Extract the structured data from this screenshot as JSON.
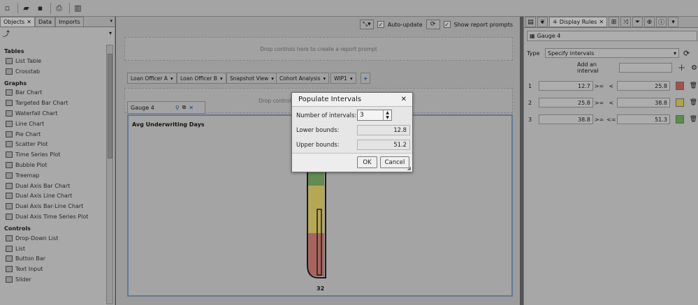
{
  "left_panel": {
    "tabs": [
      {
        "label": "Objects"
      },
      {
        "label": "Data"
      },
      {
        "label": "Imports"
      }
    ],
    "sections": [
      {
        "title": "Tables",
        "items": [
          {
            "label": "List Table"
          },
          {
            "label": "Crosstab"
          }
        ]
      },
      {
        "title": "Graphs",
        "items": [
          {
            "label": "Bar Chart"
          },
          {
            "label": "Targeted Bar Chart"
          },
          {
            "label": "Waterfall Chart"
          },
          {
            "label": "Line Chart"
          },
          {
            "label": "Pie Chart"
          },
          {
            "label": "Scatter Plot"
          },
          {
            "label": "Time Series Plot"
          },
          {
            "label": "Bubble Plot"
          },
          {
            "label": "Treemap"
          },
          {
            "label": "Dual Axis Bar Chart"
          },
          {
            "label": "Dual Axis Line Chart"
          },
          {
            "label": "Dual Axis Bar-Line Chart"
          },
          {
            "label": "Dual Axis Time Series Plot"
          }
        ]
      },
      {
        "title": "Controls",
        "items": [
          {
            "label": "Drop-Down List"
          },
          {
            "label": "List"
          },
          {
            "label": "Button Bar"
          },
          {
            "label": "Text Input"
          },
          {
            "label": "Slider"
          }
        ]
      }
    ]
  },
  "center": {
    "auto_update_label": "Auto-update",
    "show_prompts_label": "Show report prompts",
    "drop_top": "Drop controls here to create a report prompt",
    "drop_middle": "Drop controls here to create a section prompt",
    "filter_tabs": [
      {
        "label": "Loan Officer A"
      },
      {
        "label": "Loan Officer B"
      },
      {
        "label": "Snapshot View"
      },
      {
        "label": "Cohort Analysis"
      },
      {
        "label": "WIP1"
      }
    ],
    "gauge_tab_label": "Gauge 4",
    "gauge_title": "Avg Underwriting Days",
    "gauge_value": "32",
    "gauge_fill_fraction": 0.56,
    "gauge_colors": {
      "green": "#7fb36a",
      "yellow": "#e9d66e",
      "red": "#d9807a"
    }
  },
  "right_panel": {
    "tab_label": "Display Rules",
    "object_select": "Gauge 4",
    "type_label": "Type",
    "type_value": "Specify intervals",
    "add_interval_label": "Add an interval",
    "intervals": [
      {
        "index": "1",
        "low": "12.7",
        "op1": ">=",
        "op2": "<",
        "high": "25.8",
        "color": "#d06a5f"
      },
      {
        "index": "2",
        "low": "25.8",
        "op1": ">=",
        "op2": "<",
        "high": "38.8",
        "color": "#e6d45c"
      },
      {
        "index": "3",
        "low": "38.8",
        "op1": ">=",
        "op2": "<=",
        "high": "51.3",
        "color": "#74b860"
      }
    ]
  },
  "dialog": {
    "title": "Populate Intervals",
    "num_intervals_label": "Number of intervals:",
    "num_intervals_value": "3",
    "lower_label": "Lower bounds:",
    "lower_value": "12.8",
    "upper_label": "Upper bounds:",
    "upper_value": "51.2",
    "ok_label": "OK",
    "cancel_label": "Cancel"
  }
}
